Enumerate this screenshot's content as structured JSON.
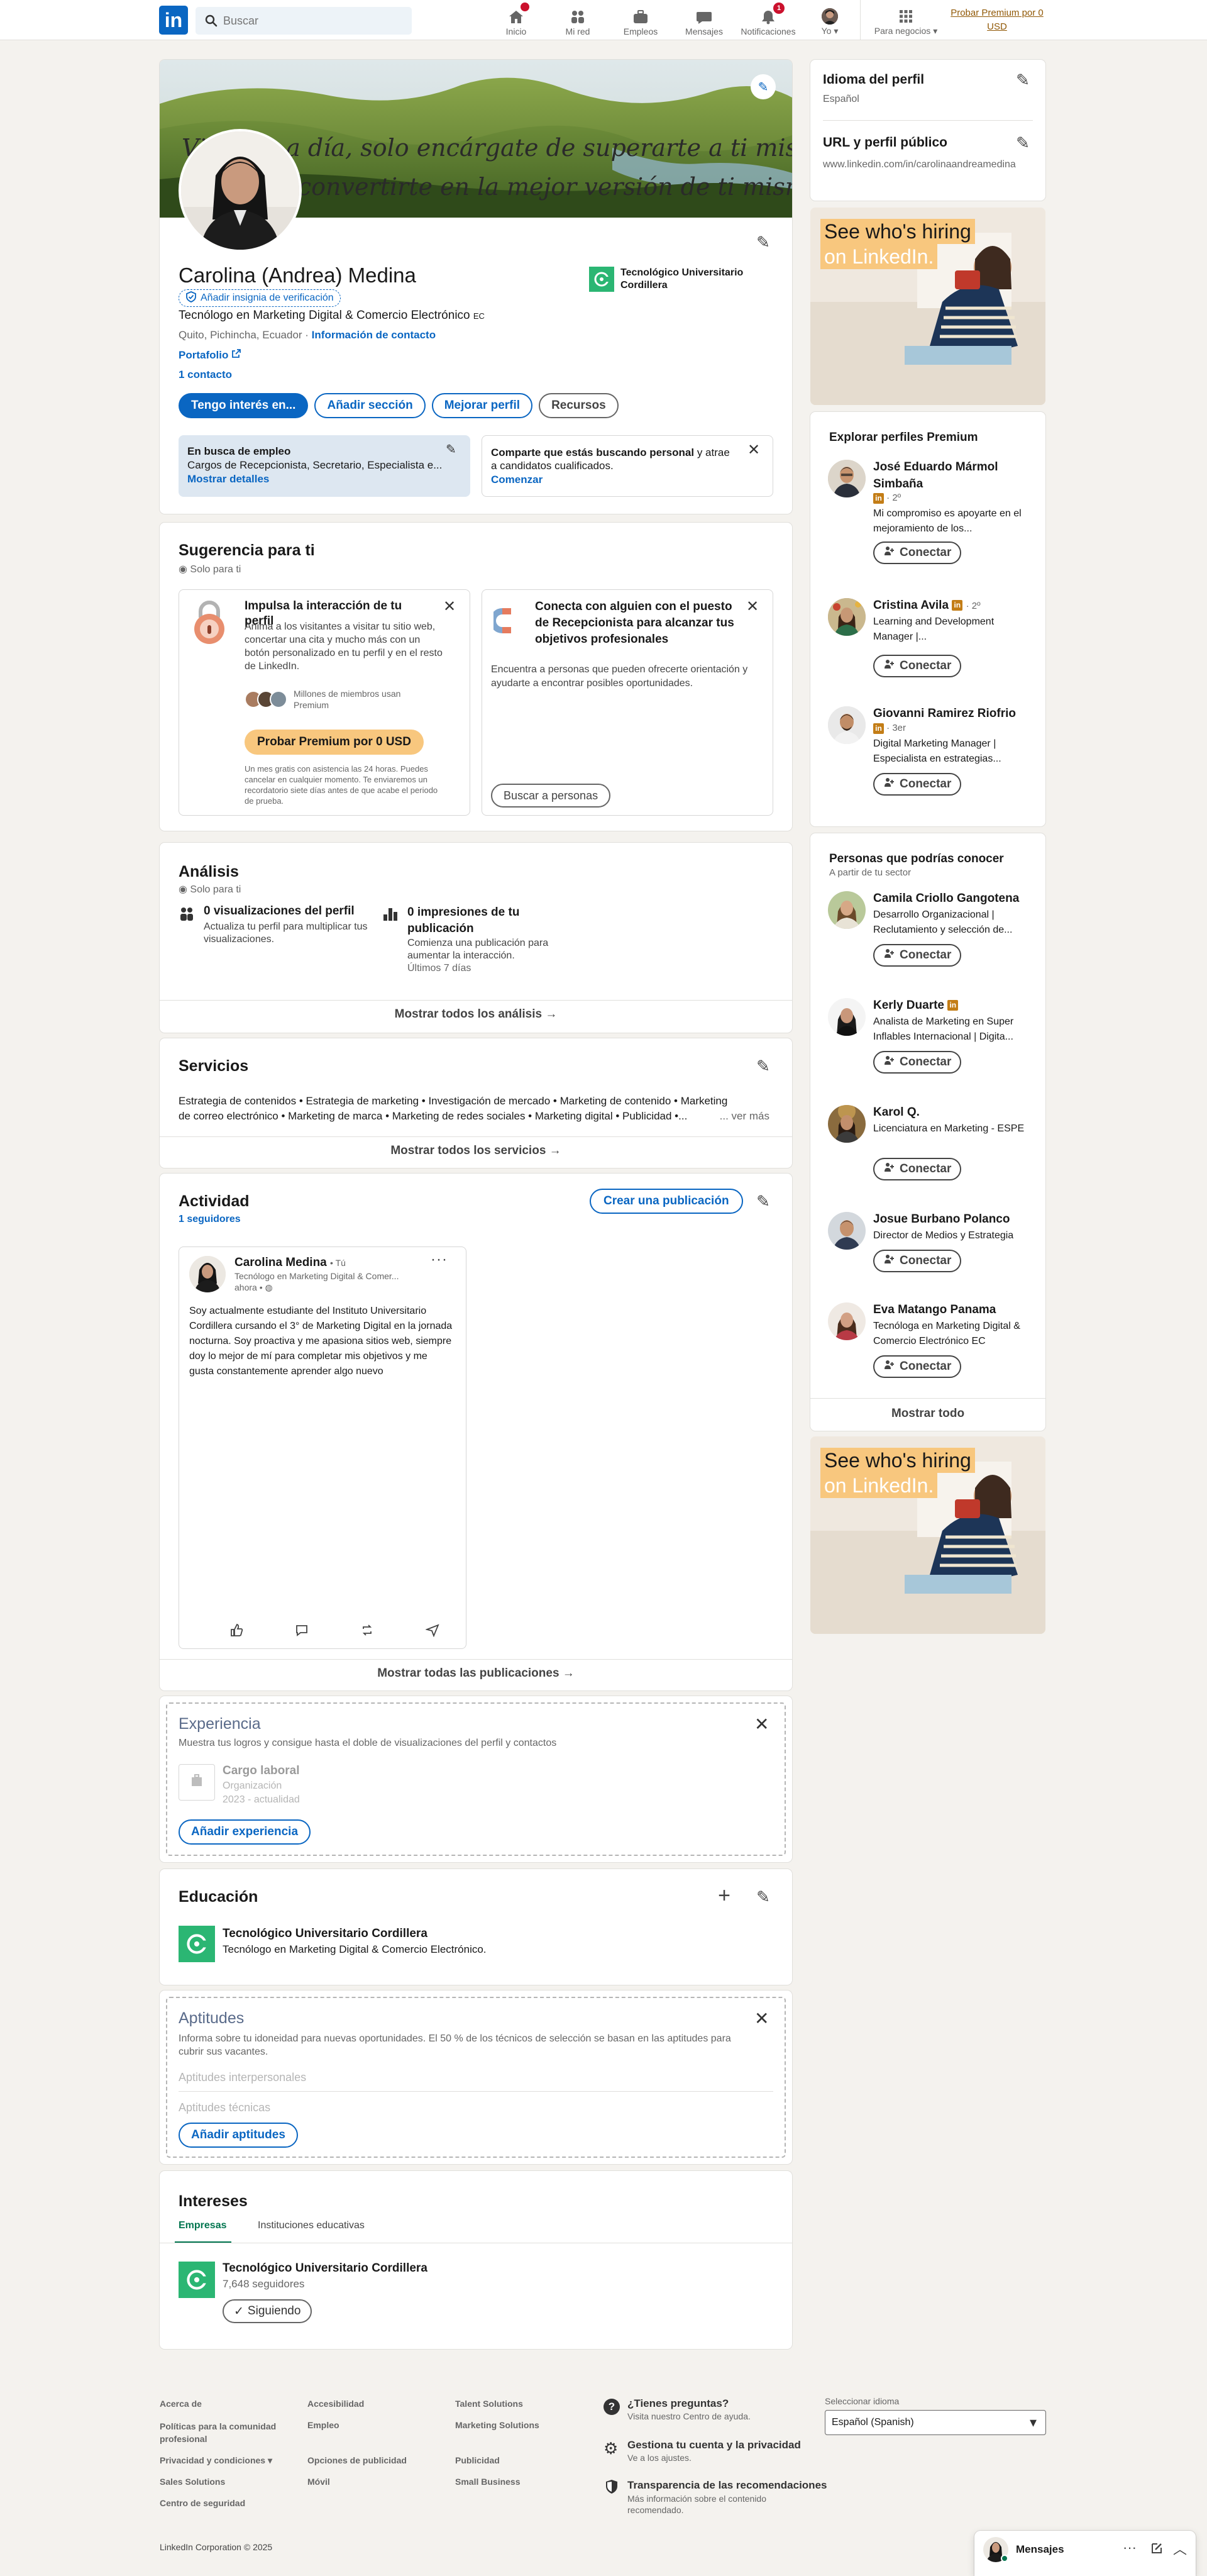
{
  "nav": {
    "search_placeholder": "Buscar",
    "items": [
      {
        "label": "Inicio",
        "icon": "home-icon"
      },
      {
        "label": "Mi red",
        "icon": "network-icon"
      },
      {
        "label": "Empleos",
        "icon": "jobs-icon"
      },
      {
        "label": "Mensajes",
        "icon": "messaging-icon"
      },
      {
        "label": "Notificaciones",
        "icon": "bell-icon",
        "badge": "1"
      },
      {
        "label": "Yo",
        "icon": "avatar"
      },
      {
        "label": "Para negocios",
        "icon": "grid-icon"
      }
    ],
    "premium_line1": "Probar Premium por 0",
    "premium_line2": "USD"
  },
  "profile": {
    "banner_quote_line1": "Vive día a día, solo encárgate de superarte a ti misma siempre",
    "banner_quote_line2": "para convertirte en la mejor versión de ti misma que puedas.",
    "name": "Carolina (Andrea) Medina",
    "verify_label": "Añadir insignia de verificación",
    "headline": "Tecnólogo en Marketing Digital & Comercio Electrónico",
    "headline_suffix": "EC",
    "location": "Quito, Pichincha, Ecuador",
    "contact_info": "Información de contacto",
    "portfolio": "Portafolio",
    "connections": "1 contacto",
    "school": "Tecnológico Universitario Cordillera",
    "btn_open_to": "Tengo interés en...",
    "btn_add_section": "Añadir sección",
    "btn_enhance": "Mejorar perfil",
    "btn_resources": "Recursos",
    "open_to_work_title": "En busca de empleo",
    "open_to_work_desc": "Cargos de Recepcionista, Secretario, Especialista e...",
    "open_to_work_link": "Mostrar detalles",
    "hiring_text_bold": "Comparte que estás buscando personal",
    "hiring_text_rest": " y atrae a candidatos cualificados.",
    "hiring_link": "Comenzar"
  },
  "suggested": {
    "title": "Sugerencia para ti",
    "private": "Solo para ti",
    "card1_title": "Impulsa la interacción de tu perfil",
    "card1_body": "Anima a los visitantes a visitar tu sitio web, concertar una cita y mucho más con un botón personalizado en tu perfil y en el resto de LinkedIn.",
    "card1_members": "Millones de miembros usan Premium",
    "card1_button": "Probar Premium por 0 USD",
    "card1_fine": "Un mes gratis con asistencia las 24 horas. Puedes cancelar en cualquier momento. Te enviaremos un recordatorio siete días antes de que acabe el periodo de prueba.",
    "card2_title": "Conecta con alguien con el puesto de Recepcionista para alcanzar tus objetivos profesionales",
    "card2_body": "Encuentra a personas que pueden ofrecerte orientación y ayudarte a encontrar posibles oportunidades.",
    "card2_button": "Buscar a personas"
  },
  "analytics": {
    "title": "Análisis",
    "private": "Solo para ti",
    "views_title": "0 visualizaciones del perfil",
    "views_desc": "Actualiza tu perfil para multiplicar tus visualizaciones.",
    "impressions_title": "0 impresiones de tu publicación",
    "impressions_desc": "Comienza una publicación para aumentar la interacción.",
    "impressions_period": "Últimos 7 días",
    "show_all": "Mostrar todos los análisis →"
  },
  "services": {
    "title": "Servicios",
    "list_line1": "Estrategia de contenidos • Estrategia de marketing • Investigación de mercado • Marketing de contenido • Marketing",
    "list_line2": "de correo electrónico • Marketing de marca • Marketing de redes sociales • Marketing digital • Publicidad •...",
    "see_more": "... ver más",
    "show_all": "Mostrar todos los servicios →"
  },
  "activity": {
    "title": "Actividad",
    "followers": "1 seguidores",
    "create_post": "Crear una publicación",
    "post_author": "Carolina Medina",
    "post_you": "• Tú",
    "post_headline": "Tecnólogo en Marketing Digital & Comer...",
    "post_time": "ahora •",
    "post_text": "Soy actualmente estudiante del Instituto Universitario Cordillera cursando el 3° de Marketing Digital en la jornada nocturna. Soy proactiva y me apasiona sitios web, siempre doy lo mejor de mí para completar mis objetivos y me gusta constantemente aprender algo nuevo",
    "show_all": "Mostrar todas las publicaciones →"
  },
  "experience": {
    "title": "Experiencia",
    "desc": "Muestra tus logros y consigue hasta el doble de visualizaciones del perfil y contactos",
    "job_title": "Cargo laboral",
    "org": "Organización",
    "dates": "2023 - actualidad",
    "add_button": "Añadir experiencia"
  },
  "education": {
    "title": "Educación",
    "school": "Tecnológico Universitario Cordillera",
    "degree": "Tecnólogo en Marketing Digital & Comercio Electrónico."
  },
  "skills": {
    "title": "Aptitudes",
    "desc": "Informa sobre tu idoneidad para nuevas oportunidades. El 50 % de los técnicos de selección se basan en las aptitudes para cubrir sus vacantes.",
    "interpersonal": "Aptitudes interpersonales",
    "technical": "Aptitudes técnicas",
    "add_button": "Añadir aptitudes"
  },
  "interests": {
    "title": "Intereses",
    "tab1": "Empresas",
    "tab2": "Instituciones educativas",
    "company": "Tecnológico Universitario Cordillera",
    "followers": "7,648 seguidores",
    "following_btn": "Siguiendo"
  },
  "sidebar": {
    "lang_title": "Idioma del perfil",
    "lang_value": "Español",
    "url_title": "URL y perfil público",
    "url_value": "www.linkedin.com/in/carolinaandreamedina",
    "ad_line1": "See who's hiring",
    "ad_line2": "on LinkedIn.",
    "premium_title": "Explorar perfiles Premium",
    "connect_label": "Conectar",
    "premium_people": [
      {
        "name": "José Eduardo Mármol Simbaña",
        "degree": "· 2º",
        "desc": "Mi compromiso es apoyarte en el mejoramiento de los..."
      },
      {
        "name": "Cristina Avila",
        "degree": "· 2º",
        "desc": "Learning and Development Manager |..."
      },
      {
        "name": "Giovanni Ramirez Riofrio",
        "degree": "· 3er",
        "desc": "Digital Marketing Manager | Especialista en estrategias..."
      }
    ],
    "pymk_title": "Personas que podrías conocer",
    "pymk_sub": "A partir de tu sector",
    "pymk_people": [
      {
        "name": "Camila Criollo Gangotena",
        "desc": "Desarrollo Organizacional | Reclutamiento y selección de..."
      },
      {
        "name": "Kerly Duarte",
        "desc": "Analista de Marketing en Super Inflables Internacional | Digita..."
      },
      {
        "name": "Karol Q.",
        "desc": "Licenciatura en Marketing - ESPE"
      },
      {
        "name": "Josue Burbano Polanco",
        "desc": "Director de Medios y Estrategia"
      },
      {
        "name": "Eva Matango Panama",
        "desc": "Tecnóloga en Marketing Digital & Comercio Electrónico EC"
      }
    ],
    "show_all": "Mostrar todo"
  },
  "footer": {
    "col1": [
      "Acerca de",
      "Políticas para la comunidad profesional",
      "Privacidad y condiciones",
      "Sales Solutions",
      "Centro de seguridad"
    ],
    "col2": [
      "Accesibilidad",
      "Empleo",
      "Opciones de publicidad",
      "Móvil"
    ],
    "col3": [
      "Talent Solutions",
      "Marketing Solutions",
      "Publicidad",
      "Small Business"
    ],
    "help_title": "¿Tienes preguntas?",
    "help_sub": "Visita nuestro Centro de ayuda.",
    "manage_title": "Gestiona tu cuenta y la privacidad",
    "manage_sub": "Ve a los ajustes.",
    "transp_title": "Transparencia de las recomendaciones",
    "transp_sub": "Más información sobre el contenido recomendado.",
    "lang_label": "Seleccionar idioma",
    "lang_value": "Español (Spanish)",
    "copyright": "LinkedIn Corporation © 2025"
  },
  "messaging": {
    "label": "Mensajes"
  },
  "colors": {
    "brand": "#0a66c2",
    "premium": "#f8c77e",
    "background": "#f4f2ee",
    "notification": "#cb112d",
    "school_logo": "#2bb673"
  }
}
